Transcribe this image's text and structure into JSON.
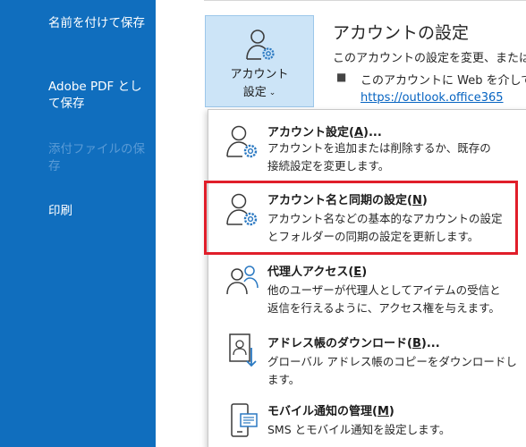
{
  "sidebar": {
    "items": [
      {
        "label": "名前を付けて保存",
        "enabled": true
      },
      {
        "label": "Adobe PDF として保存",
        "enabled": true
      },
      {
        "label": "添付ファイルの保存",
        "enabled": false
      },
      {
        "label": "印刷",
        "enabled": true
      }
    ]
  },
  "account_button": {
    "line1": "アカウント",
    "line2": "設定",
    "chevron": "⌄"
  },
  "section": {
    "title": "アカウントの設定",
    "description": "このアカウントの設定を変更、または追",
    "bullet": "■",
    "bullet_text": "このアカウントに Web を介して",
    "link": "https://outlook.office365"
  },
  "menu": {
    "items": [
      {
        "title_pre": "アカウント設定(",
        "key": "A",
        "title_post": ")...",
        "desc": "アカウントを追加または削除するか、既存の\n接続設定を変更します。",
        "icon": "account-settings-icon"
      },
      {
        "title_pre": "アカウント名と同期の設定(",
        "key": "N",
        "title_post": ")",
        "desc": "アカウント名などの基本的なアカウントの設定\nとフォルダーの同期の設定を更新します。",
        "icon": "account-sync-settings-icon"
      },
      {
        "title_pre": "代理人アクセス(",
        "key": "E",
        "title_post": ")",
        "desc": "他のユーザーが代理人としてアイテムの受信と\n返信を行えるように、アクセス権を与えます。",
        "icon": "delegate-access-icon"
      },
      {
        "title_pre": "アドレス帳のダウンロード(",
        "key": "B",
        "title_post": ")...",
        "desc": "グローバル アドレス帳のコピーをダウンロードし\nます。",
        "icon": "address-book-download-icon"
      },
      {
        "title_pre": "モバイル通知の管理(",
        "key": "M",
        "title_post": ")",
        "desc": "SMS とモバイル通知を設定します。",
        "icon": "mobile-notification-icon"
      }
    ]
  },
  "colors": {
    "sidebar_bg": "#106ebe",
    "button_bg": "#cce4f7",
    "highlight": "#e01e2a",
    "link": "#0563c1"
  }
}
